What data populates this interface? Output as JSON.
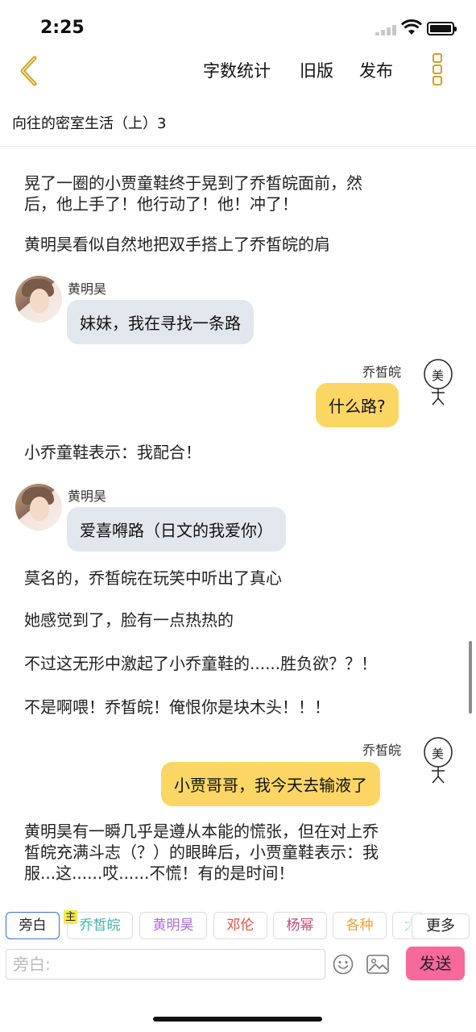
{
  "status_bar": {
    "time": "2:25"
  },
  "nav": {
    "actions": [
      "字数统计",
      "旧版",
      "发布"
    ]
  },
  "doc": {
    "title": "向往的密室生活（上）3"
  },
  "content": {
    "narration_1": [
      "晃了一圈的小贾童鞋终于晃到了乔皙皖面前，然",
      "后，他上手了！他行动了！他！冲了！"
    ],
    "narration_2": "黄明昊看似自然地把双手搭上了乔皙皖的肩",
    "msg_1": {
      "speaker": "黄明昊",
      "text": "妹妹，我在寻找一条路"
    },
    "msg_2": {
      "speaker": "乔皙皖",
      "text": "什么路?"
    },
    "narration_3": "小乔童鞋表示：我配合！",
    "msg_3": {
      "speaker": "黄明昊",
      "text": "爱喜嘚路（日文的我爱你）"
    },
    "narration_4": "莫名的，乔皙皖在玩笑中听出了真心",
    "narration_5": "她感觉到了，脸有一点热热的",
    "narration_6": "不过这无形中激起了小乔童鞋的......胜负欲？？！",
    "narration_7": "不是啊喂！乔皙皖！俺恨你是块木头！！！",
    "msg_4": {
      "speaker": "乔皙皖",
      "text": "小贾哥哥，我今天去输液了"
    },
    "narration_8": [
      "黄明昊有一瞬几乎是遵从本能的慌张，但在对上乔",
      "皙皖充满斗志（？）的眼眸后，小贾童鞋表示：我",
      "服...这......哎......不慌！有的是时间！"
    ]
  },
  "chips": {
    "master_badge": "主",
    "items": [
      {
        "label": "旁白",
        "color": "#222222"
      },
      {
        "label": "乔皙皖",
        "color": "#3fb8a8"
      },
      {
        "label": "黄明昊",
        "color": "#a86cd6"
      },
      {
        "label": "邓伦",
        "color": "#e0503a"
      },
      {
        "label": "杨幂",
        "color": "#c34a7a"
      },
      {
        "label": "各种",
        "color": "#e8a33d"
      },
      {
        "label": "大",
        "color": "#3fb8c8"
      }
    ],
    "more": "更多"
  },
  "input": {
    "placeholder": "旁白:",
    "send": "发送"
  },
  "colors": {
    "accent_gold": "#c9a227",
    "bubble_left": "#e2e7ee",
    "bubble_right": "#fcd665",
    "send_button": "#f7689b",
    "selected_border": "#3b6fd4"
  }
}
